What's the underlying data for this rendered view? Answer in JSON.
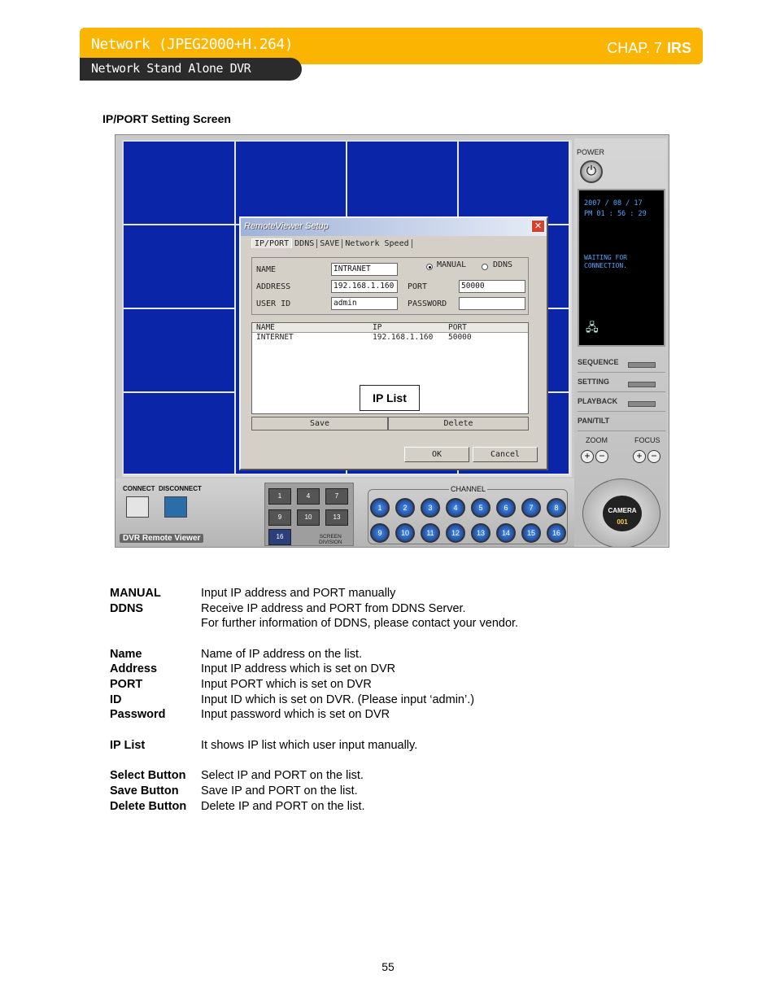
{
  "header": {
    "title": "Network (JPEG2000+H.264)",
    "subtitle": "Network Stand Alone DVR",
    "chap_label": "CHAP. 7",
    "chap_brand": "IRS",
    "accent_color": "#fbb400"
  },
  "section_title": "IP/PORT Setting Screen",
  "app": {
    "power_label": "POWER",
    "date_line": "2007 / 08 / 17",
    "time_line": "PM 01 : 56 : 29",
    "status_line1": "WAITING FOR",
    "status_line2": "CONNECTION.",
    "right_buttons": [
      "SEQUENCE",
      "SETTING",
      "PLAYBACK",
      "PAN/TILT"
    ],
    "zoom_label": "ZOOM",
    "focus_label": "FOCUS",
    "camera_label": "CAMERA",
    "camera_num": "001",
    "connect_label": "CONNECT",
    "disconnect_label": "DISCONNECT",
    "brand_label": "DVR Remote Viewer",
    "division_buttons": [
      "1",
      "4",
      "7",
      "9",
      "10",
      "13",
      "16"
    ],
    "screen_division_label1": "SCREEN",
    "screen_division_label2": "DIVISION",
    "channel_label": "CHANNEL",
    "channels": [
      "1",
      "2",
      "3",
      "4",
      "5",
      "6",
      "7",
      "8",
      "9",
      "10",
      "11",
      "12",
      "13",
      "14",
      "15",
      "16"
    ]
  },
  "dialog": {
    "title": "RemoteViewer Setup",
    "close_glyph": "✕",
    "tabs": [
      "IP/PORT",
      "DDNS",
      "SAVE",
      "Network Speed"
    ],
    "name_label": "NAME",
    "name_value": "INTRANET",
    "address_label": "ADDRESS",
    "address_value": "192.168.1.160",
    "userid_label": "USER ID",
    "userid_value": "admin",
    "manual_label": "MANUAL",
    "ddns_label": "DDNS",
    "port_label": "PORT",
    "port_value": "50000",
    "password_label": "PASSWORD",
    "password_value": "",
    "list_headers": [
      "NAME",
      "IP",
      "PORT"
    ],
    "list_rows": [
      {
        "name": "INTERNET",
        "ip": "192.168.1.160",
        "port": "50000"
      }
    ],
    "callout": "IP List",
    "save_label": "Save",
    "delete_label": "Delete",
    "ok_label": "OK",
    "cancel_label": "Cancel"
  },
  "descriptions": [
    {
      "term": "MANUAL",
      "def": "Input  IP address and PORT manually"
    },
    {
      "term": "DDNS",
      "def": "Receive IP address and PORT from DDNS Server."
    },
    {
      "term": "",
      "def": "For further information of DDNS, please contact your vendor."
    },
    {
      "term": "Name",
      "def": "Name of IP address on the list."
    },
    {
      "term": "Address",
      "def": "Input IP address which is set on DVR"
    },
    {
      "term": "PORT",
      "def": "Input PORT which is set on DVR"
    },
    {
      "term": "ID",
      "def": "Input ID which is set on DVR. (Please input ‘admin’.)"
    },
    {
      "term": "Password",
      "def": "Input password which is set on DVR"
    },
    {
      "term": "IP List",
      "def": "It shows IP list which user input manually."
    },
    {
      "term": "Select Button",
      "def": "Select IP and PORT on the list."
    },
    {
      "term": "Save Button",
      "def": "Save IP and PORT on the list."
    },
    {
      "term": "Delete Button",
      "def": "Delete IP and PORT on the list."
    }
  ],
  "page_number": "55"
}
